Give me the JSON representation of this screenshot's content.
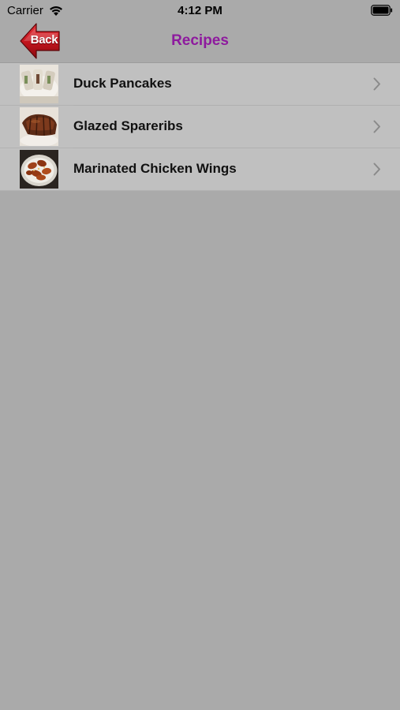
{
  "status_bar": {
    "carrier": "Carrier",
    "time": "4:12 PM",
    "wifi_icon": "wifi-icon",
    "battery_icon": "battery-icon"
  },
  "nav": {
    "back_label": "Back",
    "title": "Recipes",
    "title_color": "#8e1a9e",
    "back_color": "#c0141c"
  },
  "recipes": [
    {
      "name": "Duck Pancakes",
      "thumbnail": "duck-pancakes-photo"
    },
    {
      "name": "Glazed Spareribs",
      "thumbnail": "spareribs-photo"
    },
    {
      "name": "Marinated Chicken Wings",
      "thumbnail": "chicken-wings-photo"
    }
  ],
  "accessory_icon": "chevron-right-icon"
}
